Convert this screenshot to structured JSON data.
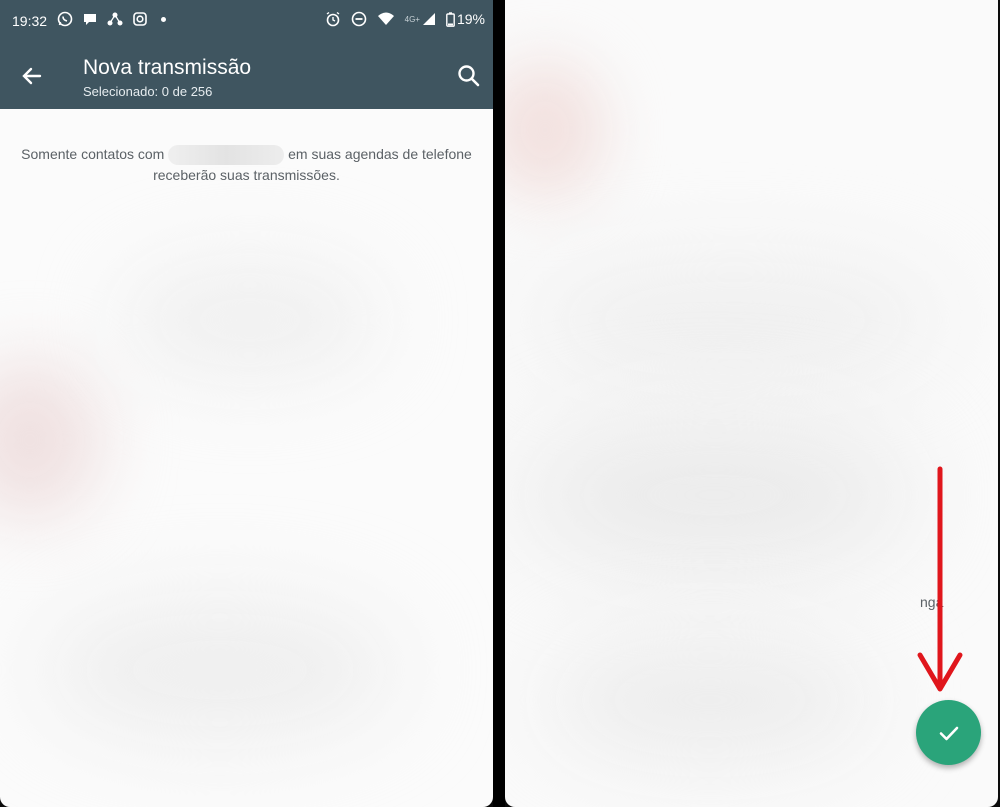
{
  "status_bar": {
    "time": "19:32",
    "network_label": "4G+",
    "battery": "19%",
    "left_icons": [
      "whatsapp-icon",
      "chat-bubble-icon",
      "share-icon",
      "instagram-icon",
      "notification-dot"
    ],
    "right_icons": [
      "alarm-icon",
      "do-not-disturb-icon",
      "wifi-icon",
      "signal-icon",
      "battery-icon"
    ]
  },
  "app_bar": {
    "title": "Nova transmissão",
    "subtitle": "Selecionado: 0 de 256",
    "back_icon": "arrow-back-icon",
    "search_icon": "search-icon"
  },
  "notice": {
    "part1": "Somente contatos com",
    "part2": "em suas agendas de telefone",
    "line2": "receberão suas transmissões."
  },
  "right_panel": {
    "partial_text": "nga"
  },
  "fab": {
    "icon": "check-icon"
  },
  "annotation": {
    "arrow_icon": "down-arrow-icon"
  },
  "colors": {
    "toolbar": "#3f5560",
    "fab": "#2aa47a",
    "arrow": "#e0161c",
    "background": "#fbfbfb"
  }
}
